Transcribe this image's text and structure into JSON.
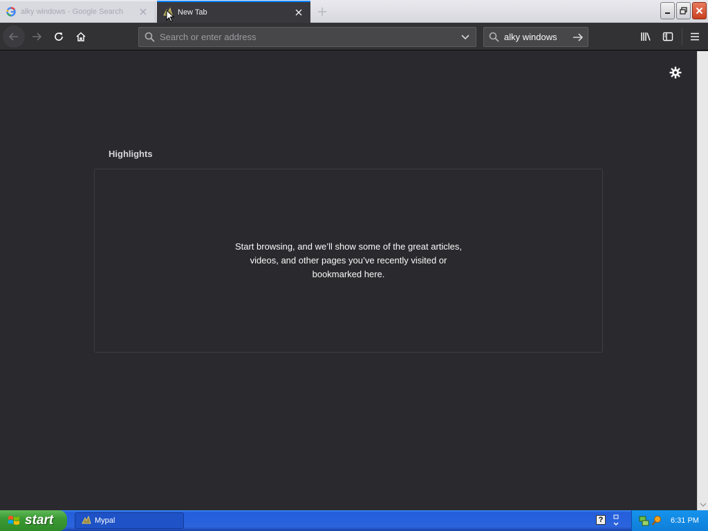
{
  "tabs": [
    {
      "title": "alky windows - Google Search",
      "favicon": "google-g-icon",
      "active": false
    },
    {
      "title": "New Tab",
      "favicon": "mypal-icon",
      "active": true
    }
  ],
  "navbar": {
    "url_placeholder": "Search or enter address",
    "url_value": "",
    "search_value": "alky windows"
  },
  "content": {
    "section_title": "Highlights",
    "empty_message": "Start browsing, and we’ll show some of the great articles, videos, and other pages you’ve recently visited or bookmarked here."
  },
  "taskbar": {
    "start_label": "start",
    "task_label": "Mypal",
    "help_label": "?",
    "clock": "6:31 PM"
  },
  "colors": {
    "accent": "#0a84ff",
    "content_bg": "#2a2a2e",
    "toolbar_bg": "#323234"
  }
}
